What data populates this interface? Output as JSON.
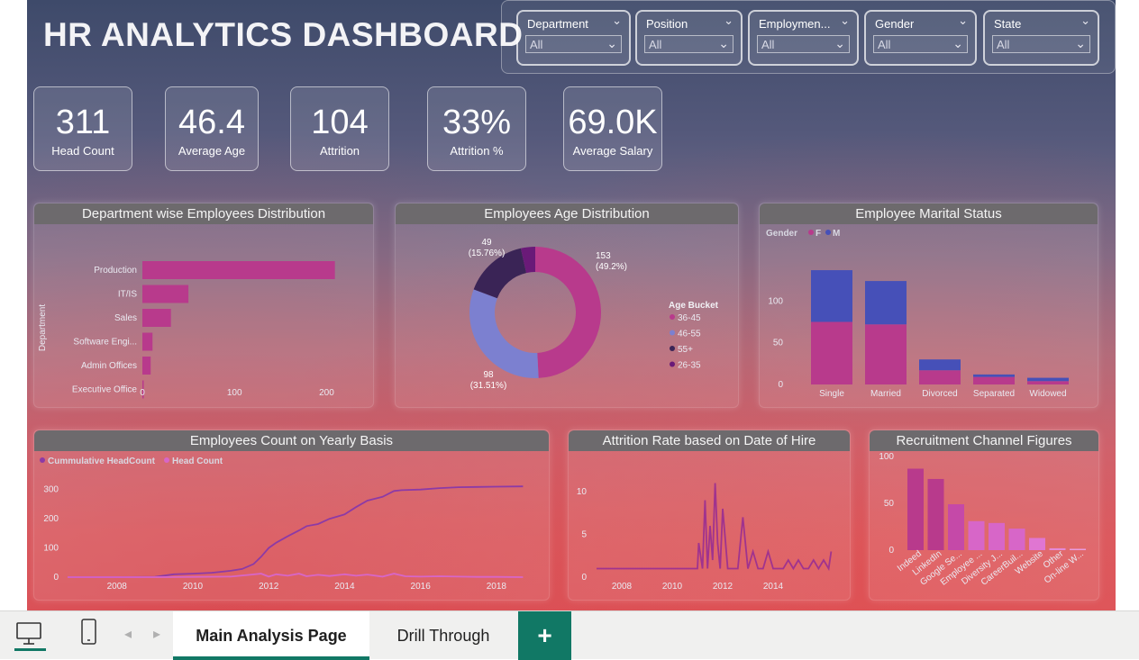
{
  "dashboard": {
    "title": "HR ANALYTICS DASHBOARD"
  },
  "slicers": [
    {
      "label": "Department",
      "value": "All"
    },
    {
      "label": "Position",
      "value": "All"
    },
    {
      "label": "Employmen...",
      "value": "All"
    },
    {
      "label": "Gender",
      "value": "All"
    },
    {
      "label": "State",
      "value": "All"
    }
  ],
  "kpis": [
    {
      "value": "311",
      "label": "Head Count"
    },
    {
      "value": "46.4",
      "label": "Average Age"
    },
    {
      "value": "104",
      "label": "Attrition"
    },
    {
      "value": "33%",
      "label": "Attrition %"
    },
    {
      "value": "69.0K",
      "label": "Average Salary"
    }
  ],
  "cards": {
    "dept": "Department wise Employees Distribution",
    "age": "Employees Age Distribution",
    "marital": "Employee Marital Status",
    "yearly": "Employees Count on Yearly Basis",
    "attrition": "Attrition Rate based on Date of Hire",
    "recruit": "Recruitment Channel Figures"
  },
  "colors": {
    "magenta": "#b83a8c",
    "blue": "#4650b8",
    "periwinkle": "#7c80d0",
    "dark_purple": "#3a2456",
    "violet": "#6a1a78",
    "light_magenta": "#d766c8",
    "line_purple": "#8c3aa6"
  },
  "chart_data": [
    {
      "type": "bar",
      "orientation": "horizontal",
      "title": "Department wise Employees Distribution",
      "ylabel": "Department",
      "categories": [
        "Production",
        "IT/IS",
        "Sales",
        "Software Engi...",
        "Admin Offices",
        "Executive Office"
      ],
      "values": [
        209,
        50,
        31,
        11,
        9,
        1
      ],
      "x_ticks": [
        "0",
        "100",
        "200"
      ],
      "xlim": [
        0,
        225
      ]
    },
    {
      "type": "pie",
      "style": "donut",
      "title": "Employees Age Distribution",
      "legend_title": "Age Bucket",
      "legend_position": "right",
      "slices": [
        {
          "name": "36-45",
          "value": 153,
          "label": "153\n(49.2%)",
          "color": "#b83a8c"
        },
        {
          "name": "46-55",
          "value": 98,
          "label": "98\n(31.51%)",
          "color": "#7c80d0"
        },
        {
          "name": "55+",
          "value": 49,
          "label": "49\n(15.76%)",
          "color": "#3a2456"
        },
        {
          "name": "26-35",
          "value": 11,
          "label": "",
          "color": "#6a1a78"
        }
      ]
    },
    {
      "type": "bar",
      "stacked": true,
      "title": "Employee Marital Status",
      "legend_title": "Gender",
      "legend_position": "top-left",
      "categories": [
        "Single",
        "Married",
        "Divorced",
        "Separated",
        "Widowed"
      ],
      "series": [
        {
          "name": "F",
          "values": [
            75,
            72,
            17,
            9,
            4
          ],
          "color": "#b83a8c"
        },
        {
          "name": "M",
          "values": [
            62,
            52,
            13,
            3,
            4
          ],
          "color": "#4650b8"
        }
      ],
      "y_ticks": [
        "0",
        "50",
        "100"
      ],
      "ylim": [
        0,
        150
      ]
    },
    {
      "type": "line",
      "title": "Employees Count on Yearly Basis",
      "legend_position": "top-left",
      "x_ticks": [
        "2008",
        "2010",
        "2012",
        "2014",
        "2016",
        "2018"
      ],
      "y_ticks": [
        "0",
        "100",
        "200",
        "300"
      ],
      "xlim": [
        2006.7,
        2019.0
      ],
      "ylim": [
        0,
        330
      ],
      "series": [
        {
          "name": "Cummulative HeadCount",
          "color": "#8c3aa6",
          "x": [
            2006.7,
            2008.0,
            2009.0,
            2009.5,
            2010.0,
            2010.5,
            2011.0,
            2011.3,
            2011.6,
            2011.8,
            2012.0,
            2012.2,
            2012.5,
            2012.8,
            2013.0,
            2013.3,
            2013.6,
            2014.0,
            2014.3,
            2014.6,
            2015.0,
            2015.3,
            2015.5,
            2016.0,
            2016.5,
            2017.0,
            2017.5,
            2018.0,
            2018.7
          ],
          "y": [
            0,
            0,
            1,
            10,
            12,
            15,
            22,
            28,
            45,
            70,
            100,
            118,
            140,
            160,
            175,
            182,
            200,
            215,
            240,
            262,
            275,
            295,
            298,
            300,
            305,
            308,
            309,
            310,
            311
          ]
        },
        {
          "name": "Head Count",
          "color": "#d766c8",
          "x": [
            2006.7,
            2009.0,
            2010.0,
            2011.0,
            2011.5,
            2011.8,
            2012.0,
            2012.2,
            2012.5,
            2012.8,
            2013.0,
            2013.3,
            2013.6,
            2014.0,
            2014.3,
            2014.6,
            2015.0,
            2015.3,
            2015.6,
            2016.0,
            2016.5,
            2017.0,
            2017.5,
            2018.0,
            2018.7
          ],
          "y": [
            0,
            0,
            1,
            2,
            8,
            12,
            2,
            10,
            5,
            12,
            3,
            8,
            4,
            10,
            5,
            9,
            2,
            12,
            3,
            2,
            3,
            2,
            1,
            1,
            0
          ]
        }
      ]
    },
    {
      "type": "line",
      "title": "Attrition Rate based on Date of Hire",
      "x_ticks": [
        "2008",
        "2010",
        "2012",
        "2014"
      ],
      "y_ticks": [
        "0",
        "5",
        "10"
      ],
      "xlim": [
        2007.0,
        2016.5
      ],
      "ylim": [
        0,
        12
      ],
      "series": [
        {
          "name": "Attrition",
          "color": "#a0338e",
          "x": [
            2007.0,
            2009.0,
            2010.0,
            2011.0,
            2011.05,
            2011.2,
            2011.3,
            2011.4,
            2011.5,
            2011.6,
            2011.7,
            2011.8,
            2011.9,
            2012.0,
            2012.2,
            2012.4,
            2012.6,
            2012.8,
            2013.0,
            2013.2,
            2013.4,
            2013.6,
            2013.8,
            2014.0,
            2014.2,
            2014.4,
            2014.6,
            2014.8,
            2015.0,
            2015.2,
            2015.4,
            2015.6,
            2015.8,
            2016.0,
            2016.2,
            2016.3
          ],
          "y": [
            1,
            1,
            1,
            1,
            4,
            1,
            9,
            1,
            6,
            2,
            11,
            4,
            1,
            8,
            1,
            1,
            1,
            7,
            1,
            3,
            1,
            1,
            3,
            1,
            1,
            1,
            2,
            1,
            2,
            1,
            1,
            2,
            1,
            2,
            1,
            3
          ]
        }
      ]
    },
    {
      "type": "bar",
      "title": "Recruitment Channel Figures",
      "categories": [
        "Indeed",
        "LinkedIn",
        "Google Se...",
        "Employee ...",
        "Diversity J...",
        "CareerBuil...",
        "Website",
        "Other",
        "On-line W..."
      ],
      "values": [
        87,
        76,
        49,
        31,
        29,
        23,
        13,
        2,
        1
      ],
      "colors": [
        "#b83a8c",
        "#b83a8c",
        "#c549a8",
        "#d766c8",
        "#d766c8",
        "#d766c8",
        "#e076d2",
        "#e58ad8",
        "#ea9ade"
      ],
      "y_ticks": [
        "0",
        "50",
        "100"
      ],
      "ylim": [
        0,
        100
      ]
    }
  ],
  "tabs": {
    "main": "Main Analysis Page",
    "drill": "Drill Through",
    "add": "+"
  }
}
